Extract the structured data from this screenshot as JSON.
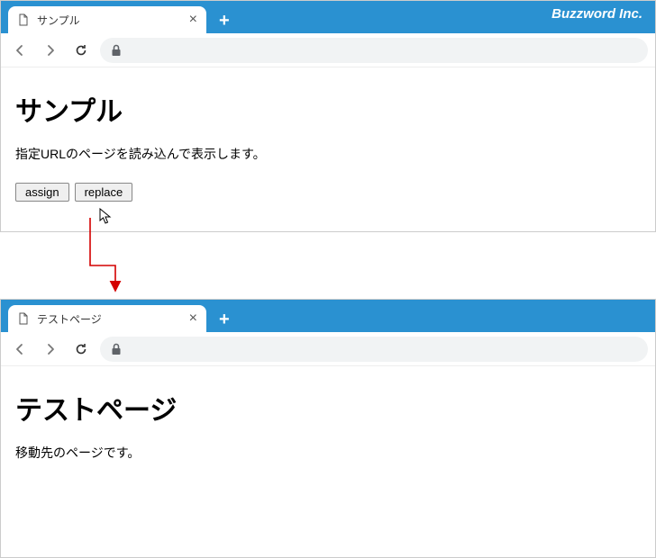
{
  "brand": "Buzzword Inc.",
  "window1": {
    "tab_label": "サンプル",
    "heading": "サンプル",
    "paragraph": "指定URLのページを読み込んで表示します。",
    "buttons": {
      "assign": "assign",
      "replace": "replace"
    }
  },
  "window2": {
    "tab_label": "テストページ",
    "heading": "テストページ",
    "paragraph": "移動先のページです。"
  }
}
